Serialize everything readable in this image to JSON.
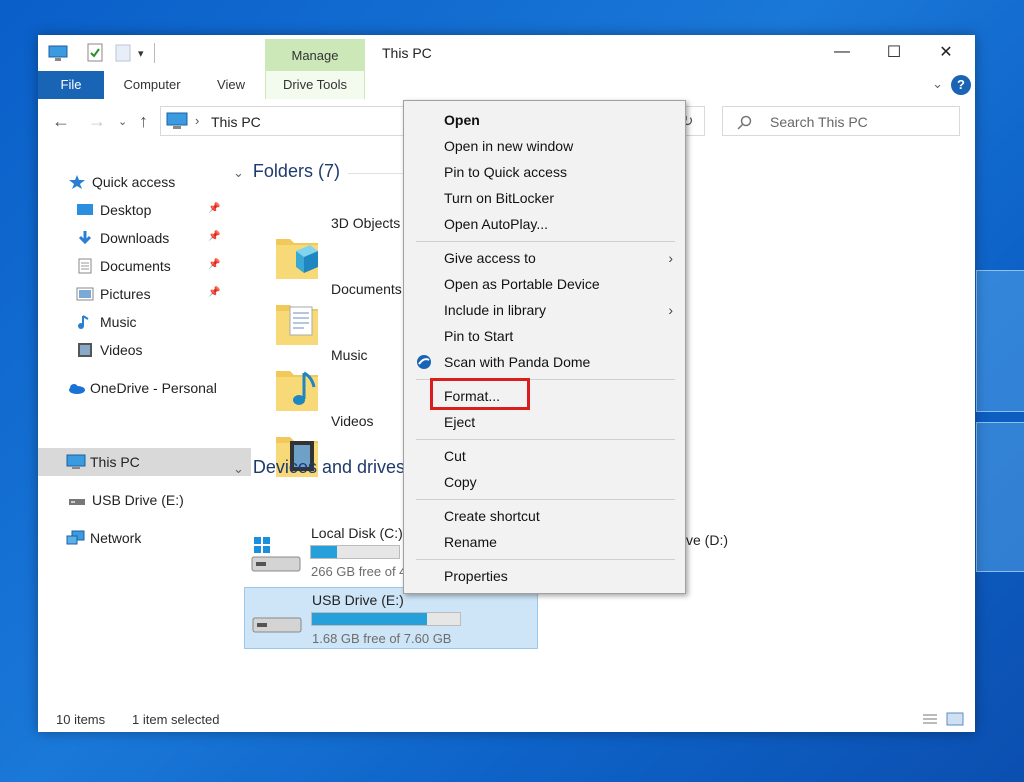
{
  "window": {
    "title": "This PC",
    "context_tab": "Manage",
    "tabs": [
      "File",
      "Computer",
      "View",
      "Drive Tools"
    ],
    "caption_buttons": {
      "minimize": "—",
      "maximize": "☐",
      "close": "✕"
    },
    "help": "?"
  },
  "address": {
    "path": "This PC",
    "search_placeholder": "Search This PC"
  },
  "nav": {
    "quick_access": "Quick access",
    "items": [
      "Desktop",
      "Downloads",
      "Documents",
      "Pictures",
      "Music",
      "Videos"
    ],
    "onedrive": "OneDrive - Personal",
    "this_pc": "This PC",
    "usb": "USB Drive (E:)",
    "network": "Network"
  },
  "content": {
    "folders_header": "Folders (7)",
    "folders": [
      "3D Objects",
      "Documents",
      "Music",
      "Videos"
    ],
    "devices_header": "Devices and drives",
    "drives": [
      {
        "name": "Local Disk (C:)",
        "free": "266 GB free of 4",
        "used_fraction": 0.3
      },
      {
        "name": "USB Drive (E:)",
        "free": "1.68 GB free of 7.60 GB",
        "used_fraction": 0.78
      }
    ],
    "drive_d_partial": "ve (D:)"
  },
  "status": {
    "items": "10 items",
    "selected": "1 item selected"
  },
  "context_menu": {
    "group1": [
      "Open",
      "Open in new window",
      "Pin to Quick access",
      "Turn on BitLocker",
      "Open AutoPlay..."
    ],
    "group2": [
      "Give access to",
      "Open as Portable Device",
      "Include in library",
      "Pin to Start",
      "Scan with Panda Dome"
    ],
    "group3": [
      "Format...",
      "Eject"
    ],
    "group4": [
      "Cut",
      "Copy"
    ],
    "group5": [
      "Create shortcut",
      "Rename"
    ],
    "group6": [
      "Properties"
    ]
  },
  "colors": {
    "accent": "#1a64b5",
    "drive_bar": "#26a0da",
    "highlight": "#d91e1e",
    "context_tab": "#cde8b8"
  }
}
